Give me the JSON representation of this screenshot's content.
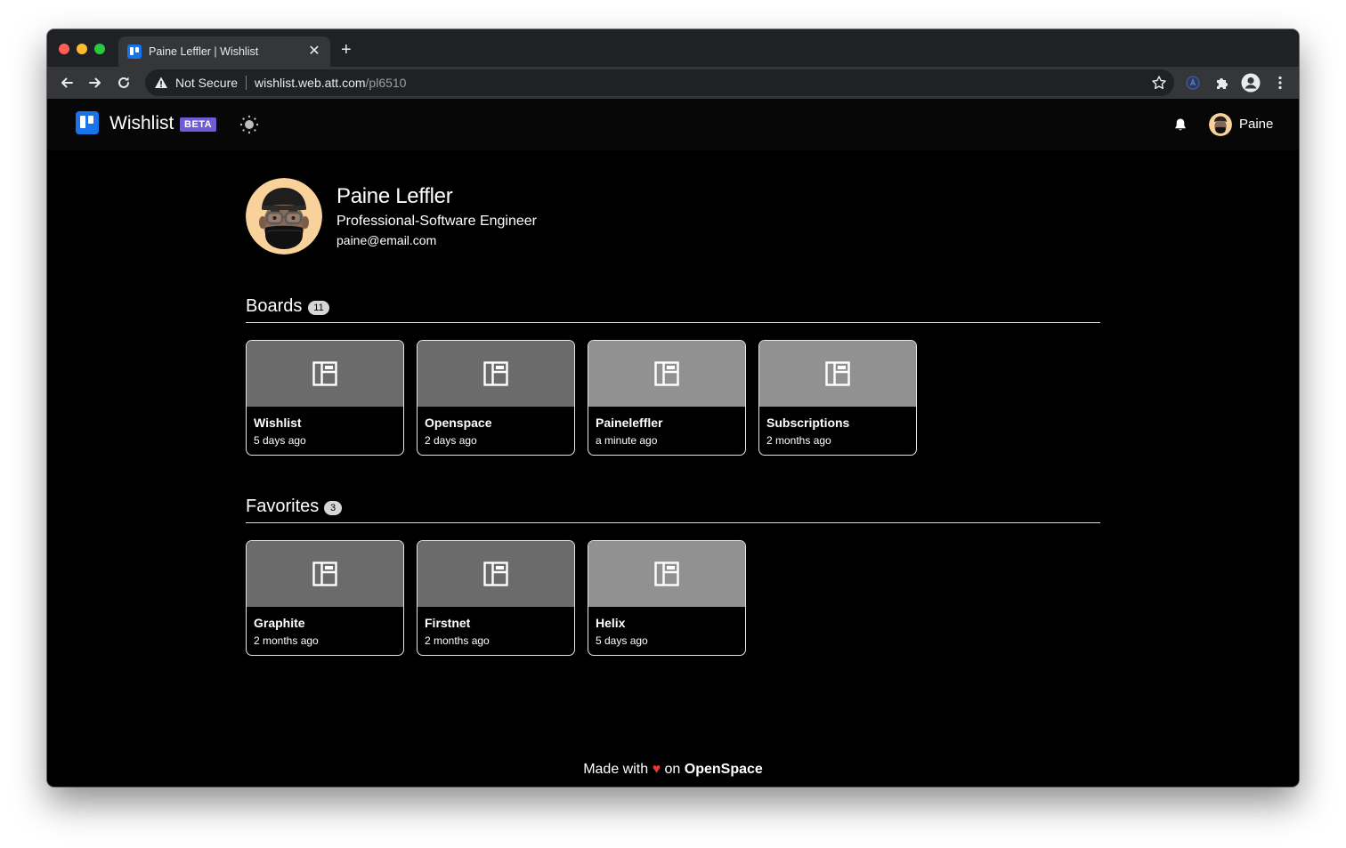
{
  "browser": {
    "tab_title": "Paine Leffler | Wishlist",
    "close_glyph": "✕",
    "new_tab_glyph": "+",
    "security_label": "Not Secure",
    "url_host": "wishlist.web.att.com",
    "url_path": "/pl6510"
  },
  "app": {
    "brand": "Wishlist",
    "beta_label": "BETA",
    "user_short_name": "Paine",
    "accent_color": "#1a73e8",
    "beta_color": "#6f5bd6"
  },
  "profile": {
    "name": "Paine Leffler",
    "role": "Professional-Software Engineer",
    "email": "paine@email.com"
  },
  "boards": {
    "title": "Boards",
    "count": "11",
    "items": [
      {
        "name": "Wishlist",
        "time": "5 days ago",
        "shade": "dark"
      },
      {
        "name": "Openspace",
        "time": "2 days ago",
        "shade": "dark"
      },
      {
        "name": "Paineleffler",
        "time": "a minute ago",
        "shade": "light"
      },
      {
        "name": "Subscriptions",
        "time": "2 months ago",
        "shade": "light"
      }
    ]
  },
  "favorites": {
    "title": "Favorites",
    "count": "3",
    "items": [
      {
        "name": "Graphite",
        "time": "2 months ago",
        "shade": "dark"
      },
      {
        "name": "Firstnet",
        "time": "2 months ago",
        "shade": "dark"
      },
      {
        "name": "Helix",
        "time": "5 days ago",
        "shade": "light"
      }
    ]
  },
  "footer": {
    "made_with": "Made with",
    "heart": "♥",
    "on": "on",
    "brand": "OpenSpace"
  }
}
